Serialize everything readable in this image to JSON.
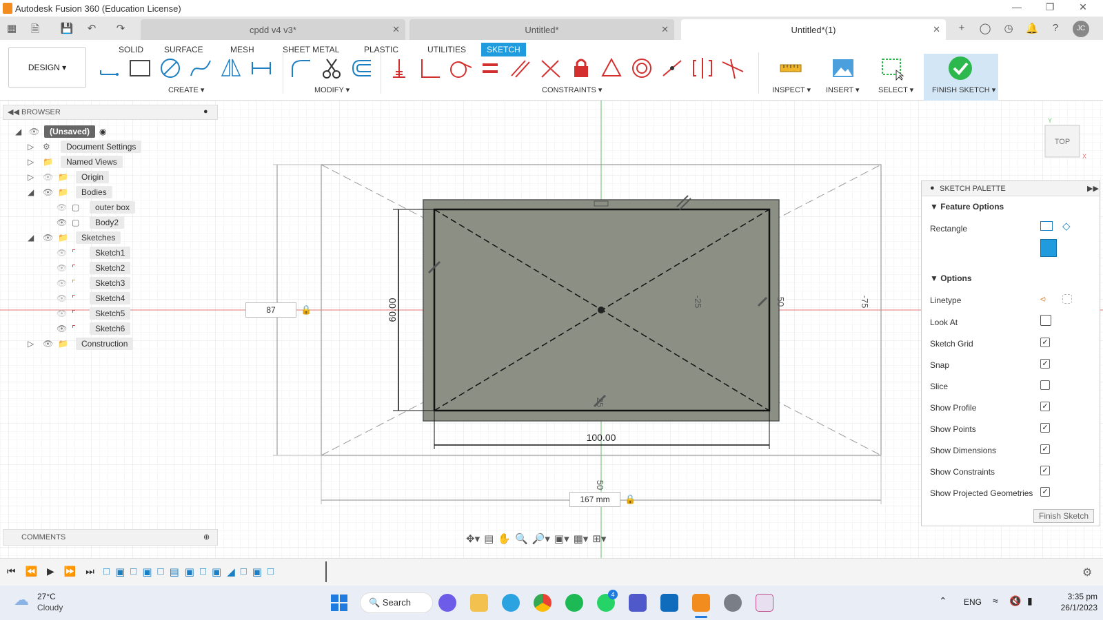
{
  "window": {
    "title": "Autodesk Fusion 360 (Education License)"
  },
  "tabs": [
    {
      "label": "cpdd v4 v3*"
    },
    {
      "label": "Untitled*"
    },
    {
      "label": "Untitled*(1)"
    }
  ],
  "ribbon": {
    "workspace": "DESIGN ▾",
    "tabs": [
      "SOLID",
      "SURFACE",
      "MESH",
      "SHEET METAL",
      "PLASTIC",
      "UTILITIES",
      "SKETCH"
    ],
    "groups": {
      "create": "CREATE ▾",
      "modify": "MODIFY ▾",
      "constraints": "CONSTRAINTS ▾",
      "inspect": "INSPECT ▾",
      "insert": "INSERT ▾",
      "select": "SELECT ▾",
      "finish": "FINISH SKETCH ▾"
    }
  },
  "browser": {
    "title": "BROWSER",
    "items": [
      {
        "label": "(Unsaved)"
      },
      {
        "label": "Document Settings"
      },
      {
        "label": "Named Views"
      },
      {
        "label": "Origin"
      },
      {
        "label": "Bodies"
      },
      {
        "label": "outer box"
      },
      {
        "label": "Body2"
      },
      {
        "label": "Sketches"
      },
      {
        "label": "Sketch1"
      },
      {
        "label": "Sketch2"
      },
      {
        "label": "Sketch3"
      },
      {
        "label": "Sketch4"
      },
      {
        "label": "Sketch5"
      },
      {
        "label": "Sketch6"
      },
      {
        "label": "Construction"
      }
    ]
  },
  "comments": {
    "title": "COMMENTS"
  },
  "canvas": {
    "dim_width": "100.00",
    "dim_height": "60.00",
    "input_left": "87",
    "input_bottom": "167 mm",
    "label_25a": "-25",
    "label_50a": "50",
    "label_75": "-75",
    "label_25b": "25",
    "label_50b": "50",
    "viewcube": "TOP"
  },
  "palette": {
    "title": "SKETCH PALETTE",
    "feature_options": "Feature Options",
    "rectangle": "Rectangle",
    "options": "Options",
    "rows": [
      {
        "label": "Linetype"
      },
      {
        "label": "Look At"
      },
      {
        "label": "Sketch Grid",
        "checked": true
      },
      {
        "label": "Snap",
        "checked": true
      },
      {
        "label": "Slice",
        "checked": false
      },
      {
        "label": "Show Profile",
        "checked": true
      },
      {
        "label": "Show Points",
        "checked": true
      },
      {
        "label": "Show Dimensions",
        "checked": true
      },
      {
        "label": "Show Constraints",
        "checked": true
      },
      {
        "label": "Show Projected Geometries",
        "checked": true
      }
    ],
    "finish_button": "Finish Sketch"
  },
  "taskbar": {
    "weather_temp": "27°C",
    "weather_desc": "Cloudy",
    "search": "Search",
    "lang": "ENG",
    "time": "3:35 pm",
    "date": "26/1/2023",
    "badge_whatsapp": "4"
  },
  "colors": {
    "accent": "#1f9bde",
    "finish_green": "#2db84d",
    "body_fill": "#8c8f84"
  }
}
